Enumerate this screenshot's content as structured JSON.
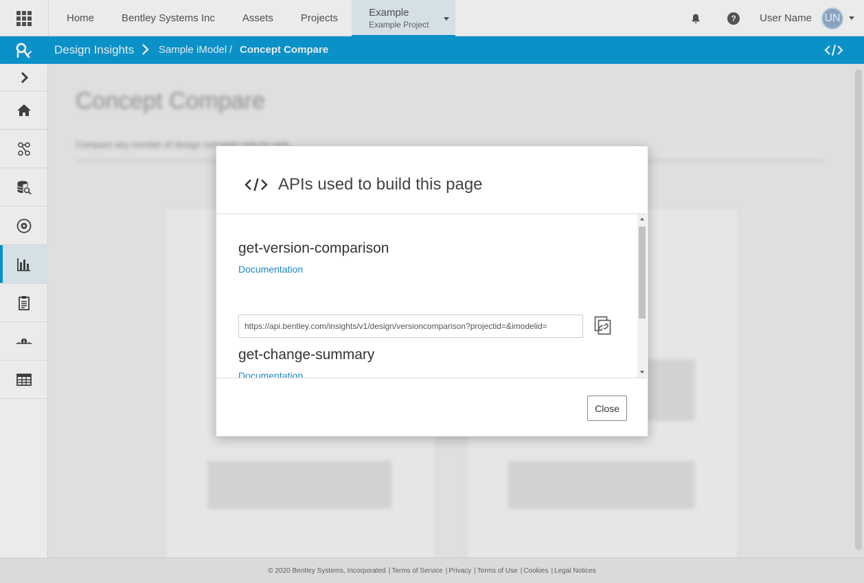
{
  "topbar": {
    "nav": [
      {
        "label": "Home"
      },
      {
        "label": "Bentley Systems Inc"
      },
      {
        "label": "Assets"
      },
      {
        "label": "Projects"
      }
    ],
    "active_context": {
      "title": "Example",
      "subtitle": "Example Project"
    },
    "user_name": "User Name",
    "avatar_initials": "UN",
    "help_glyph": "?"
  },
  "bluebar": {
    "app_name": "Design Insights",
    "crumb_imodel": "Sample iModel",
    "crumb_separator": "/",
    "crumb_page": "Concept Compare"
  },
  "sidebar": {
    "items": [
      {
        "icon": "chevron-right-icon"
      },
      {
        "icon": "home-icon"
      },
      {
        "icon": "network-icon"
      },
      {
        "icon": "database-search-icon"
      },
      {
        "icon": "settings-icon"
      },
      {
        "icon": "bar-chart-icon",
        "active": true
      },
      {
        "icon": "clipboard-icon"
      },
      {
        "icon": "info-timeline-icon"
      },
      {
        "icon": "table-icon"
      }
    ]
  },
  "background": {
    "page_title": "Concept Compare",
    "page_subtitle": "Compare any number of design concepts side-by-side"
  },
  "modal": {
    "title": "APIs used to build this page",
    "apis": [
      {
        "name": "get-version-comparison",
        "doc_label": "Documentation",
        "url": "https://api.bentley.com/insights/v1/design/versioncomparison?projectid=&imodelid="
      },
      {
        "name": "get-change-summary",
        "doc_label": "Documentation"
      }
    ],
    "close_label": "Close"
  },
  "footer": {
    "copyright": "© 2020 Bentley Systems, Incorporated",
    "links": [
      "Terms of Service",
      "Privacy",
      "Terms of Use",
      "Cookies",
      "Legal Notices"
    ]
  },
  "colors": {
    "accent": "#0a9ed9",
    "link": "#1a87c9"
  }
}
